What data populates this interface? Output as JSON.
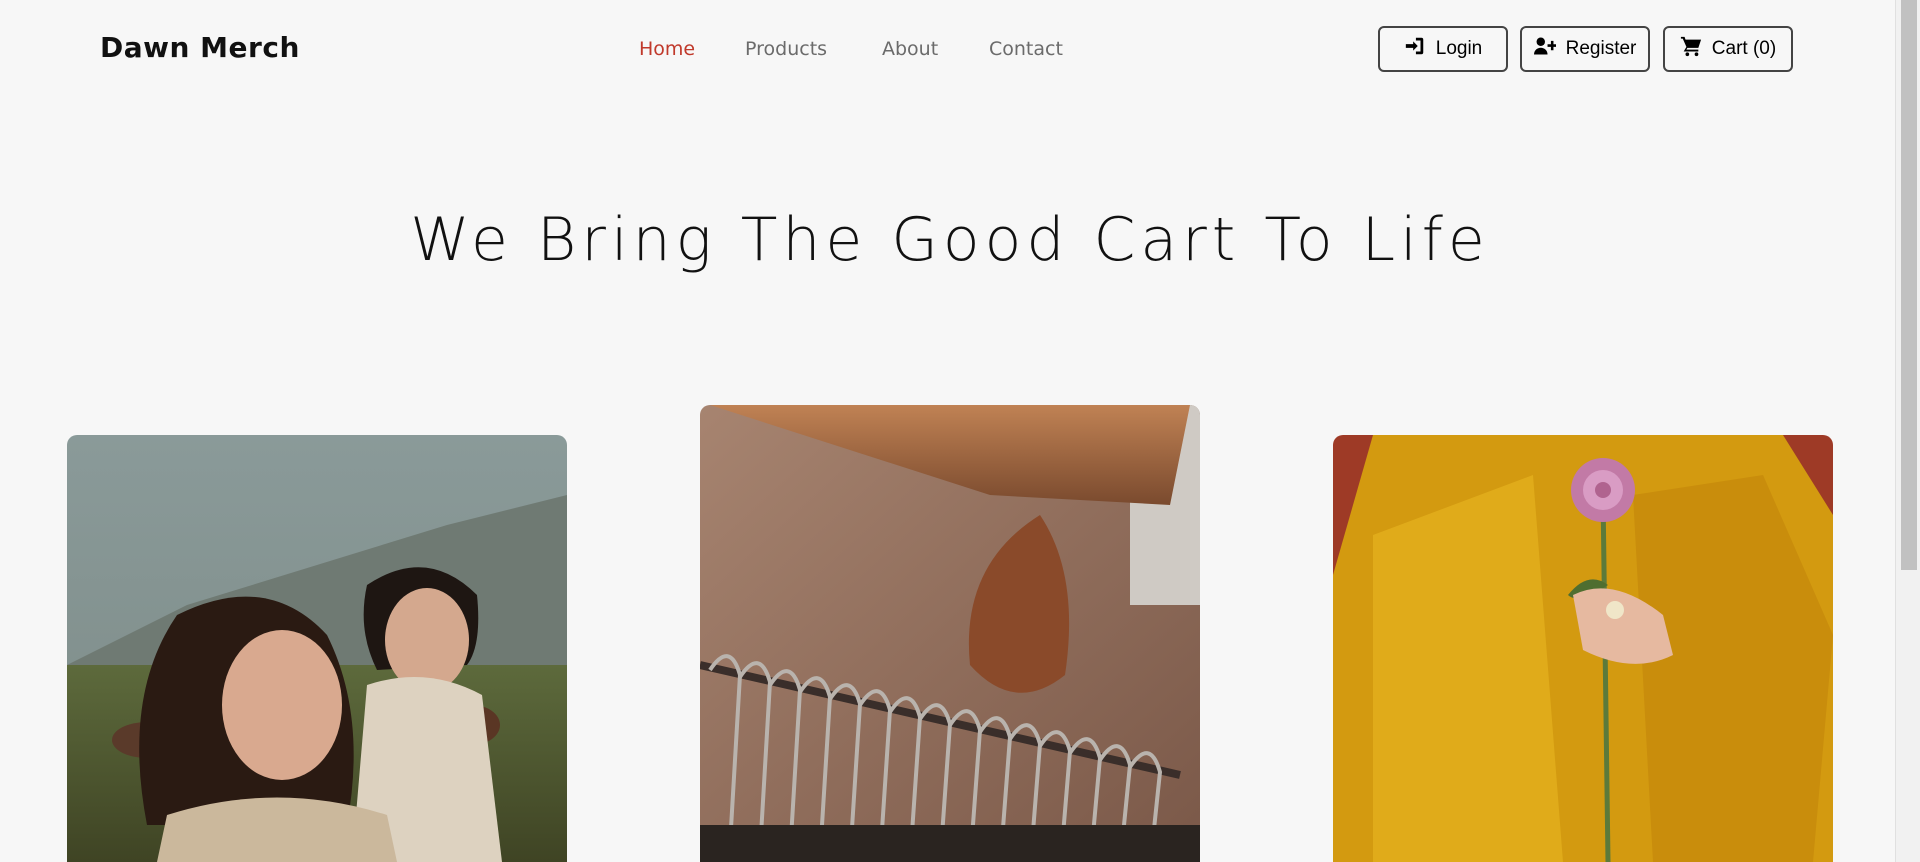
{
  "brand": "Dawn Merch",
  "nav": {
    "items": [
      {
        "label": "Home",
        "active": true
      },
      {
        "label": "Products",
        "active": false
      },
      {
        "label": "About",
        "active": false
      },
      {
        "label": "Contact",
        "active": false
      }
    ]
  },
  "actions": {
    "login": "Login",
    "register": "Register",
    "cart": "Cart (0)"
  },
  "hero": {
    "title": "We Bring The Good Cart To Life"
  },
  "colors": {
    "accent": "#c0392b",
    "background": "#f7f7f7",
    "mustard": "#d9a012",
    "rust": "#9e3a26"
  },
  "icons": {
    "login": "sign-in-icon",
    "register": "user-plus-icon",
    "cart": "shopping-cart-icon"
  }
}
